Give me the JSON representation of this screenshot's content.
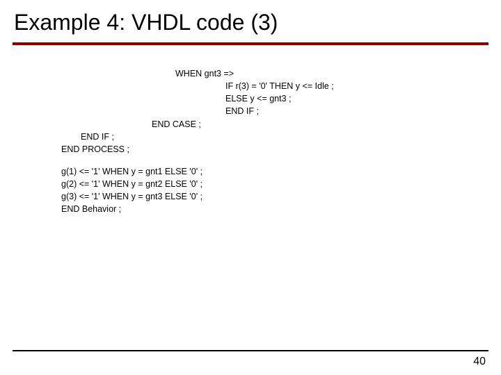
{
  "title": "Example 4: VHDL code (3)",
  "code": {
    "l1": "WHEN gnt3 =>",
    "l2": "IF r(3) = '0' THEN y <= Idle ;",
    "l3": "ELSE y <= gnt3 ;",
    "l4": "END IF ;",
    "l5": "END CASE ;",
    "l6": "END IF ;",
    "l7": "END PROCESS ;",
    "l8": "g(1) <= '1' WHEN y = gnt1 ELSE '0' ;",
    "l9": "g(2) <= '1' WHEN y = gnt2 ELSE '0' ;",
    "l10": "g(3) <= '1' WHEN y = gnt3 ELSE '0' ;",
    "l11": "END Behavior ;"
  },
  "pageNumber": "40"
}
